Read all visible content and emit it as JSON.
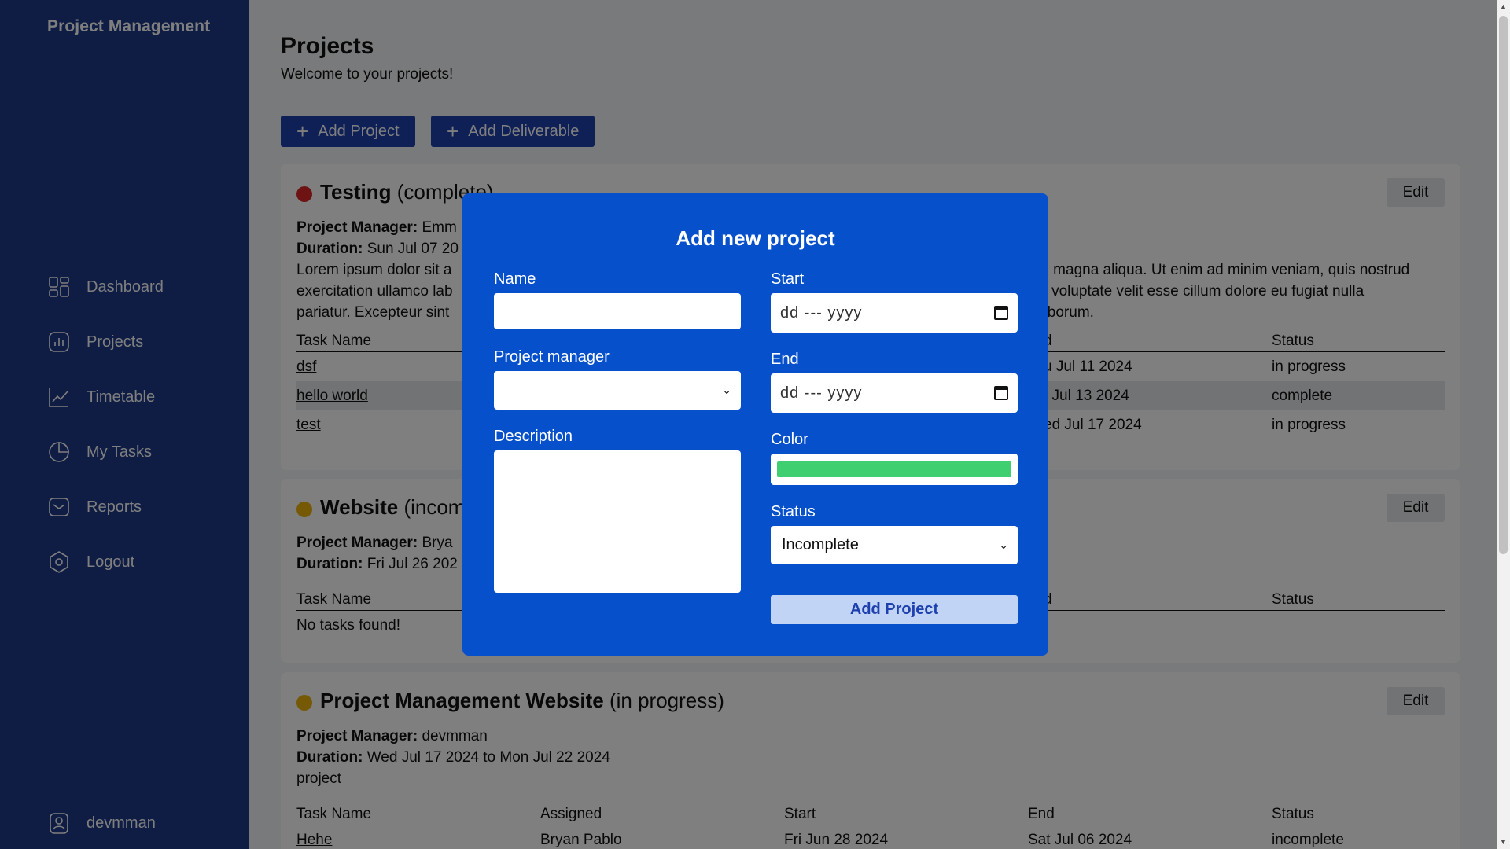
{
  "app": {
    "brand": "Project Management",
    "user": "devmman"
  },
  "nav": [
    {
      "label": "Dashboard",
      "icon": "dashboard-icon"
    },
    {
      "label": "Projects",
      "icon": "chart-icon"
    },
    {
      "label": "Timetable",
      "icon": "line-chart-icon"
    },
    {
      "label": "My Tasks",
      "icon": "pie-icon"
    },
    {
      "label": "Reports",
      "icon": "inbox-icon"
    },
    {
      "label": "Logout",
      "icon": "logout-icon"
    }
  ],
  "page": {
    "title": "Projects",
    "subtitle": "Welcome to your projects!",
    "add_project_label": "Add Project",
    "add_deliverable_label": "Add Deliverable"
  },
  "labels": {
    "edit": "Edit",
    "pm": "Project Manager:",
    "duration": "Duration:",
    "col_task": "Task Name",
    "col_assigned": "Assigned",
    "col_start": "Start",
    "col_end": "End",
    "col_status": "Status",
    "end_partial": "d"
  },
  "projects": [
    {
      "name": "Testing",
      "status": "(complete)",
      "status_visible": "(complet",
      "status_visible_tail": "e)",
      "dot_color": "#dc2626",
      "manager": "Emm",
      "duration": "Sun Jul 07 20",
      "desc_left": [
        "Lorem ipsum dolor sit a",
        "exercitation ullamco lab",
        "pariatur. Excepteur sint"
      ],
      "desc_right": [
        "re magna aliqua. Ut enim ad minim veniam, quis nostrud",
        " in voluptate velit esse cillum dolore eu fugiat nulla",
        " laborum."
      ],
      "tasks": [
        {
          "name": "dsf",
          "end": "u Jul 11 2024",
          "status": "in progress"
        },
        {
          "name": "hello world",
          "end": "t Jul 13 2024",
          "status": "complete"
        },
        {
          "name": "test",
          "end": "ed Jul 17 2024",
          "status": "in progress"
        }
      ]
    },
    {
      "name": "Website",
      "status": "(incom",
      "dot_color": "#eab308",
      "manager": "Brya",
      "duration": "Fri Jul 26 202",
      "empty": "No tasks found!"
    },
    {
      "name": "Project Management Website",
      "status": "(in progress)",
      "dot_color": "#eab308",
      "manager": "devmman",
      "duration": "Wed Jul 17 2024 to Mon Jul 22 2024",
      "description": "project",
      "tasks": [
        {
          "name": "Hehe",
          "assigned": "Bryan Pablo",
          "start": "Fri Jun 28 2024",
          "end": "Sat Jul 06 2024",
          "status": "incomplete"
        }
      ]
    }
  ],
  "modal": {
    "title": "Add new project",
    "name_label": "Name",
    "name_value": "",
    "pm_label": "Project manager",
    "pm_value": "",
    "desc_label": "Description",
    "desc_value": "",
    "start_label": "Start",
    "start_placeholder": "dd --- yyyy",
    "end_label": "End",
    "end_placeholder": "dd --- yyyy",
    "color_label": "Color",
    "color_value": "#3fcf71",
    "status_label": "Status",
    "status_value": "Incomplete",
    "submit_label": "Add Project"
  }
}
